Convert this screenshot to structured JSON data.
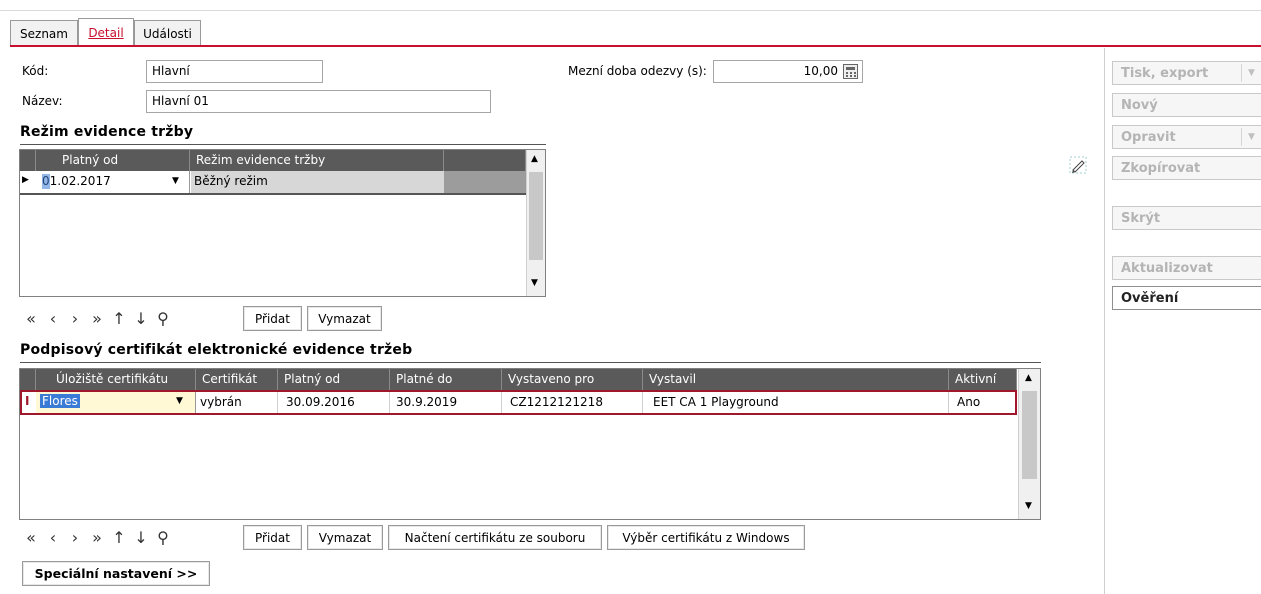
{
  "tabs": [
    {
      "label": "Seznam"
    },
    {
      "label": "Detail"
    },
    {
      "label": "Události"
    }
  ],
  "form": {
    "kod_label": "Kód:",
    "kod_value": "Hlavní",
    "nazev_label": "Název:",
    "nazev_value": "Hlavní 01",
    "mezni_label": "Mezní doba odezvy (s):",
    "mezni_value": "10,00"
  },
  "rezim": {
    "title": "Režim evidence tržby",
    "columns": [
      "Platný od",
      "Režim evidence tržby"
    ],
    "rows": [
      {
        "platny_od": "01.02.2017",
        "rezim": "Běžný režim"
      }
    ]
  },
  "certifikat": {
    "title": "Podpisový certifikát elektronické evidence tržeb",
    "columns": [
      "Úložiště certifikátu",
      "Certifikát",
      "Platný od",
      "Platné do",
      "Vystaveno pro",
      "Vystavil",
      "Aktivní"
    ],
    "rows": [
      {
        "uloziste": "Flores",
        "certifikat": "vybrán",
        "platny_od": "30.09.2016",
        "platne_do": "30.9.2019",
        "vystaveno_pro": "CZ1212121218",
        "vystavil": "EET CA 1 Playground",
        "aktivni": "Ano"
      }
    ]
  },
  "nav": {
    "first": "«",
    "prev": "‹",
    "next": "›",
    "last": "»",
    "up": "↑",
    "down": "↓",
    "search": "⚲",
    "pridat": "Přidat",
    "vymazat": "Vymazat",
    "nacteni": "Načtení certifikátu ze souboru",
    "vyber": "Výběr certifikátu z Windows"
  },
  "specialni": "Speciální nastavení >>",
  "right_buttons": {
    "tisk": "Tisk, export",
    "novy": "Nový",
    "opravit": "Opravit",
    "zkopirovat": "Zkopírovat",
    "skryt": "Skrýt",
    "aktualizovat": "Aktualizovat",
    "overeni": "Ověření"
  },
  "icons": {
    "record_pointer": "▶",
    "edit_pointer": "I",
    "dropdown": "▼",
    "scroll_up": "▲",
    "scroll_down": "▼",
    "calculator": "calculator-icon",
    "pencil": "pencil-icon"
  },
  "colors": {
    "accent": "#c8102e",
    "grid_header": "#5a5a5a",
    "selection": "#3a7bd5",
    "active_cell": "#fff9d6"
  }
}
